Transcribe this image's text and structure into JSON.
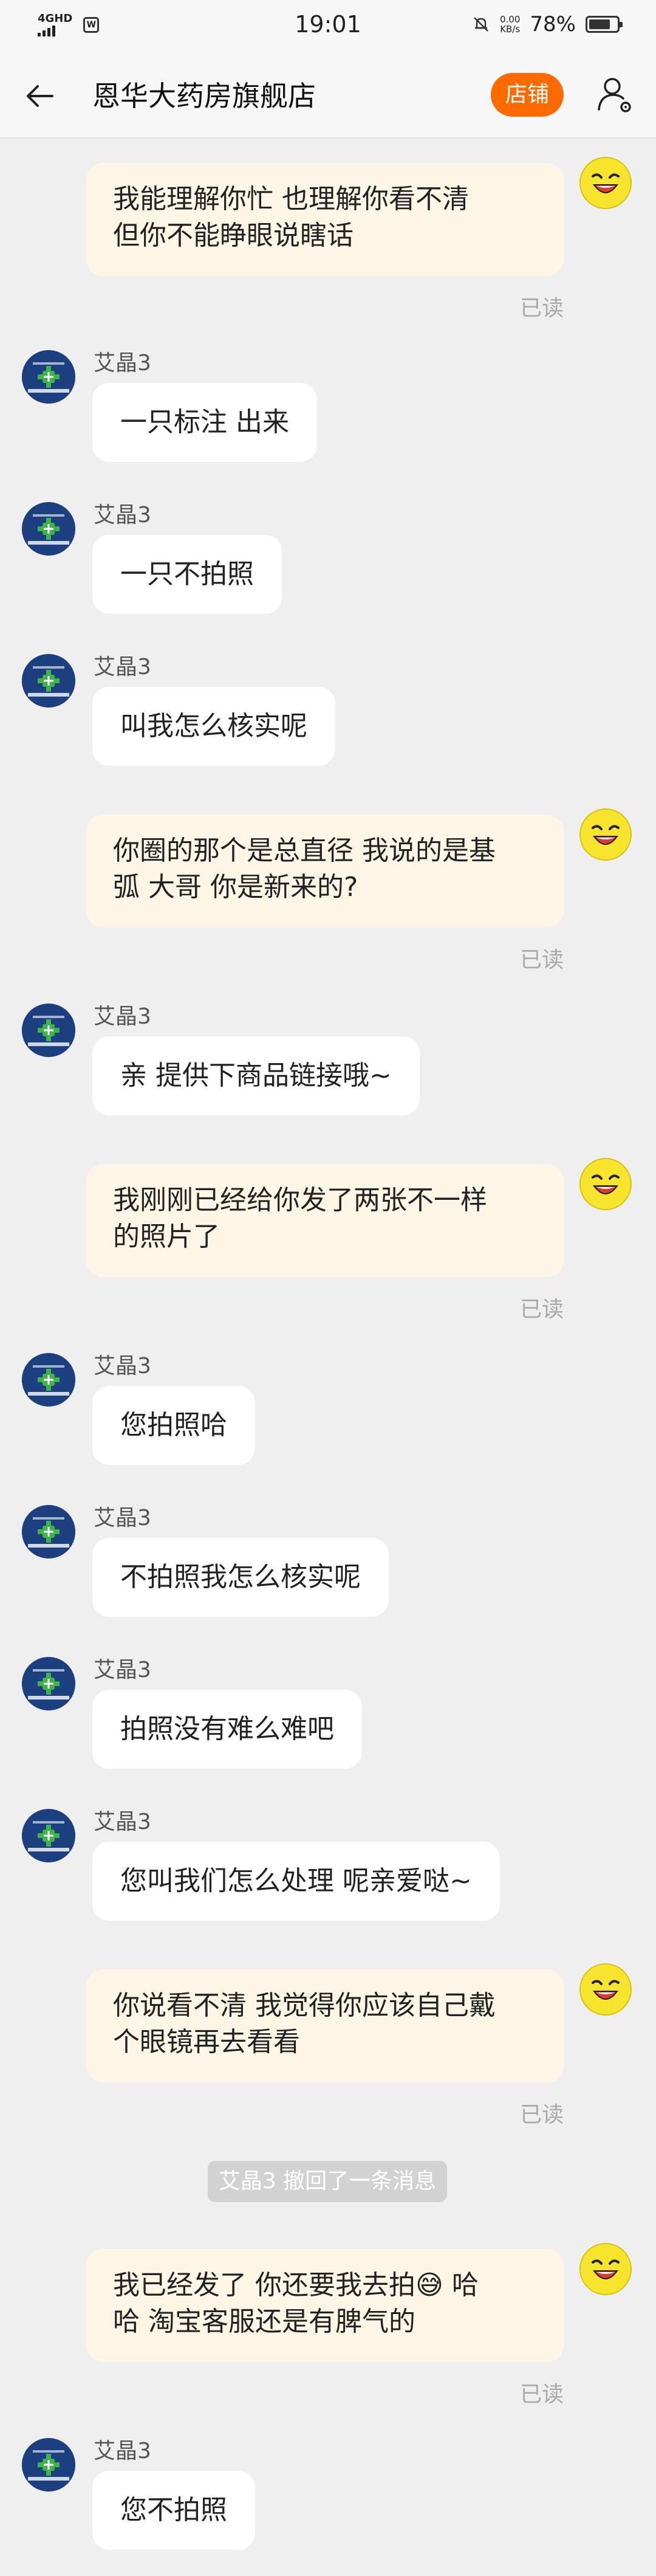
{
  "status_bar": {
    "network": "4GHD",
    "time": "19:01",
    "speed_value": "0.00",
    "speed_unit": "KB/s",
    "battery": "78%",
    "battery_level": 0.78
  },
  "header": {
    "title": "恩华大药房旗舰店",
    "shop_button": "店铺"
  },
  "colors": {
    "accent": "#ff6a00",
    "my_bubble": "#fdf6e6",
    "their_bubble": "#ffffff",
    "background": "#efefef"
  },
  "messages": [
    {
      "from": "me",
      "lines": [
        "我能理解你忙 也理解你看不清",
        "但你不能睁眼说瞎话"
      ],
      "status": "已读"
    },
    {
      "from": "them",
      "sender": "艾晶3",
      "text": "一只标注 出来"
    },
    {
      "from": "them",
      "sender": "艾晶3",
      "text": "一只不拍照"
    },
    {
      "from": "them",
      "sender": "艾晶3",
      "text": "叫我怎么核实呢"
    },
    {
      "from": "me",
      "lines": [
        "你圈的那个是总直径 我说的是基",
        "弧 大哥 你是新来的?"
      ],
      "status": "已读"
    },
    {
      "from": "them",
      "sender": "艾晶3",
      "text": "亲 提供下商品链接哦~"
    },
    {
      "from": "me",
      "lines": [
        "我刚刚已经给你发了两张不一样",
        "的照片了"
      ],
      "status": "已读"
    },
    {
      "from": "them",
      "sender": "艾晶3",
      "text": "您拍照哈"
    },
    {
      "from": "them",
      "sender": "艾晶3",
      "text": "不拍照我怎么核实呢"
    },
    {
      "from": "them",
      "sender": "艾晶3",
      "text": "拍照没有难么难吧"
    },
    {
      "from": "them",
      "sender": "艾晶3",
      "text": "您叫我们怎么处理 呢亲爱哒~"
    },
    {
      "from": "me",
      "lines": [
        "你说看不清 我觉得你应该自己戴",
        "个眼镜再去看看"
      ],
      "status": "已读"
    },
    {
      "from": "system",
      "text": "艾晶3 撤回了一条消息"
    },
    {
      "from": "me",
      "lines": [
        "我已经发了 你还要我去拍😅 哈",
        "哈 淘宝客服还是有脾气的"
      ],
      "status": "已读"
    },
    {
      "from": "them",
      "sender": "艾晶3",
      "text": "您不拍照"
    }
  ]
}
